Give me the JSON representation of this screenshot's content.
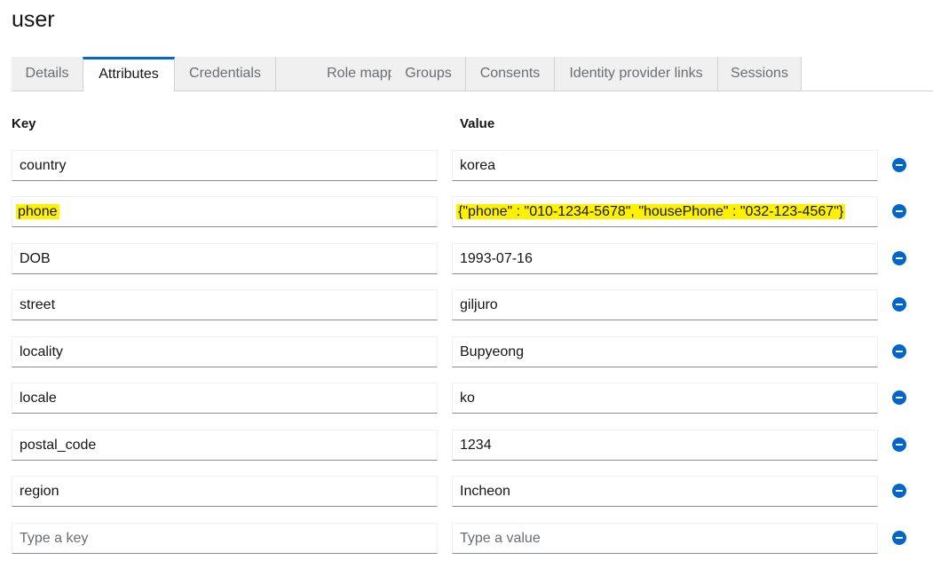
{
  "page": {
    "title": "user"
  },
  "tabs": [
    {
      "label": "Details"
    },
    {
      "label": "Attributes",
      "active": true
    },
    {
      "label": "Credentials"
    },
    {
      "label": "Role mapping"
    },
    {
      "label": "Groups"
    },
    {
      "label": "Consents"
    },
    {
      "label": "Identity provider links"
    },
    {
      "label": "Sessions"
    }
  ],
  "attributes": {
    "key_header": "Key",
    "value_header": "Value",
    "rows": [
      {
        "key": "country",
        "value": "korea"
      },
      {
        "key": "phone",
        "value": "{\"phone\" : \"010-1234-5678\", \"housePhone\" : \"032-123-4567\"}",
        "highlighted": true
      },
      {
        "key": "DOB",
        "value": "1993-07-16"
      },
      {
        "key": "street",
        "value": "giljuro"
      },
      {
        "key": "locality",
        "value": "Bupyeong"
      },
      {
        "key": "locale",
        "value": "ko"
      },
      {
        "key": "postal_code",
        "value": "1234"
      },
      {
        "key": "region",
        "value": "Incheon"
      }
    ],
    "new_row": {
      "key_placeholder": "Type a key",
      "value_placeholder": "Type a value"
    }
  },
  "colors": {
    "accent": "#0066cc",
    "highlight": "#fff200"
  },
  "icons": {
    "remove": "minus-circle-icon"
  }
}
